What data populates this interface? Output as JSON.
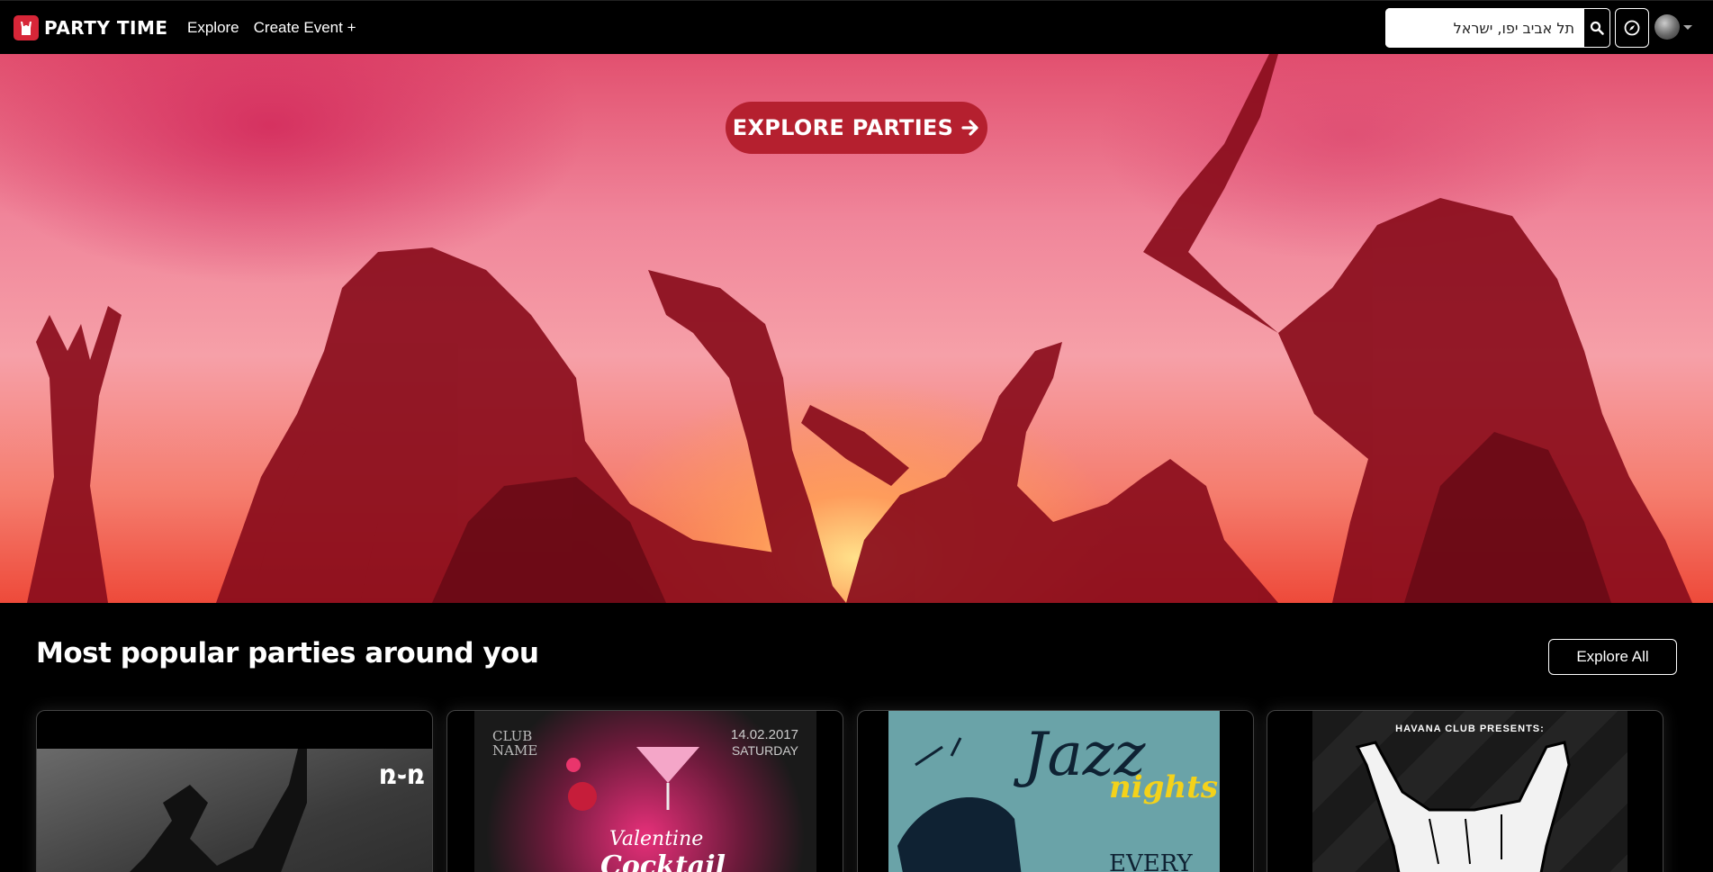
{
  "brand": {
    "name": "PARTY TIME"
  },
  "nav": {
    "explore": "Explore",
    "create_event": "Create Event +"
  },
  "search": {
    "value": "תל אביב יפו, ישראל"
  },
  "hero": {
    "button_label": "EXPLORE PARTIES"
  },
  "section": {
    "title": "Most popular parties around you",
    "explore_all": "Explore All"
  },
  "cards": [
    {
      "brand_mark": "ռ֊ռ"
    },
    {
      "top_left": "CLUB NAME",
      "date": "14.02.2017",
      "day": "SATURDAY",
      "title": "Valentine",
      "subtitle": "Cocktail"
    },
    {
      "title": "Jazz",
      "subtitle": "nights",
      "footer": "EVERY"
    },
    {
      "header": "HAVANA CLUB PRESENTS:"
    }
  ],
  "colors": {
    "accent": "#b5202f",
    "logo_red": "#d72638",
    "background": "#000000"
  }
}
